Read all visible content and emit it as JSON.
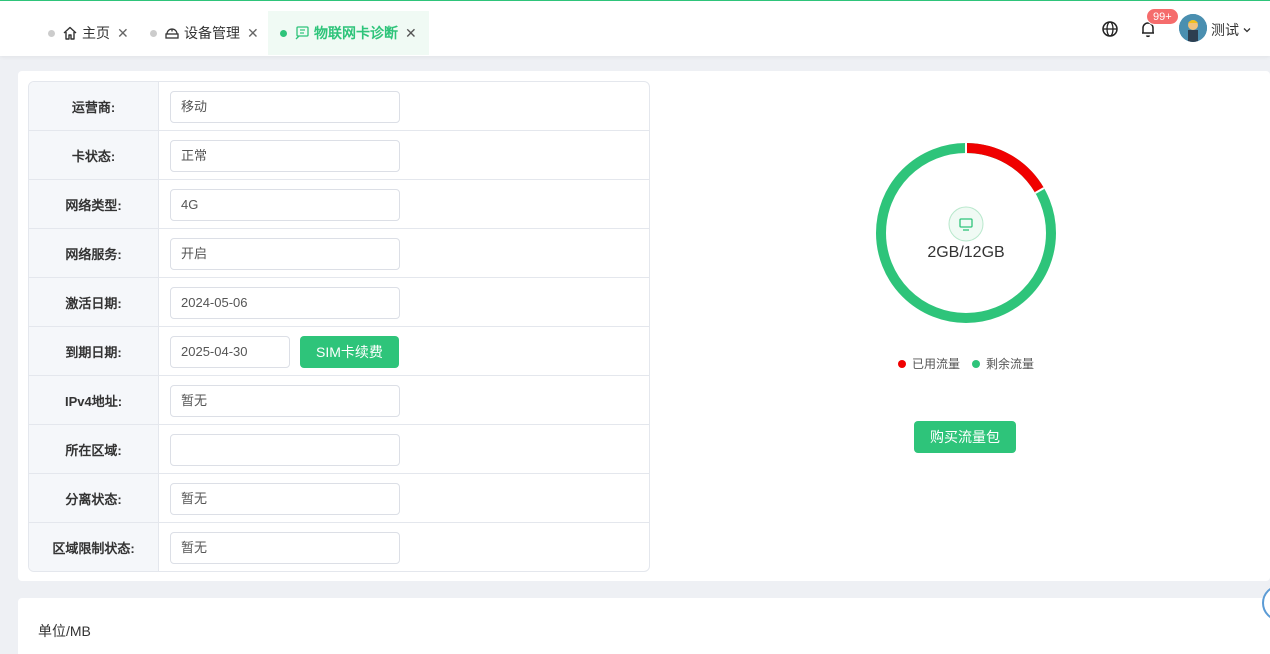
{
  "tabs": [
    {
      "label": "主页",
      "icon": "home-icon"
    },
    {
      "label": "设备管理",
      "icon": "device-icon"
    },
    {
      "label": "物联网卡诊断",
      "icon": "sim-diagnose-icon",
      "active": true
    }
  ],
  "header": {
    "notification_badge": "99+",
    "username": "测试"
  },
  "info": {
    "rows": [
      {
        "label": "运营商:",
        "value": "移动"
      },
      {
        "label": "卡状态:",
        "value": "正常"
      },
      {
        "label": "网络类型:",
        "value": "4G"
      },
      {
        "label": "网络服务:",
        "value": "开启"
      },
      {
        "label": "激活日期:",
        "value": "2024-05-06"
      },
      {
        "label": "到期日期:",
        "value": "2025-04-30"
      },
      {
        "label": "IPv4地址:",
        "value": "暂无"
      },
      {
        "label": "所在区域:",
        "value": ""
      },
      {
        "label": "分离状态:",
        "value": "暂无"
      },
      {
        "label": "区域限制状态:",
        "value": "暂无"
      }
    ],
    "renew_button": "SIM卡续费"
  },
  "traffic": {
    "center_label": "2GB/12GB",
    "used_gb": 2,
    "total_gb": 12,
    "legend": [
      {
        "label": "已用流量",
        "color": "#f00000"
      },
      {
        "label": "剩余流量",
        "color": "#2ec47a"
      }
    ],
    "buy_button": "购买流量包"
  },
  "lower": {
    "unit_label": "单位/MB"
  },
  "colors": {
    "accent": "#2ec47a",
    "used": "#f00000",
    "badge": "#f56c6c"
  }
}
